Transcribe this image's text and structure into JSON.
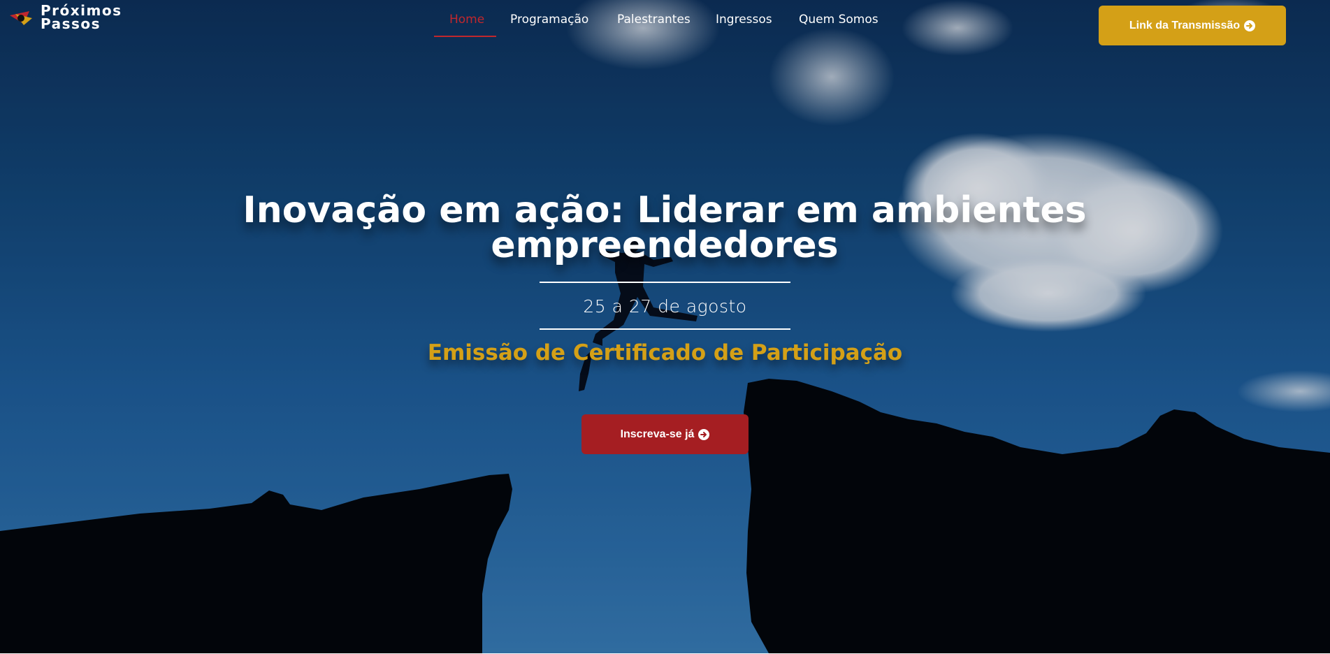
{
  "brand": {
    "name_line1": "Próximos",
    "name_line2": "Passos",
    "icon": "logo-mark-icon"
  },
  "nav": {
    "items": [
      {
        "label": "Home",
        "active": true
      },
      {
        "label": "Programação",
        "active": false
      },
      {
        "label": "Palestrantes",
        "active": false
      },
      {
        "label": "Ingressos",
        "active": false
      },
      {
        "label": "Quem Somos",
        "active": false
      }
    ]
  },
  "header": {
    "stream_button": "Link da Transmissão",
    "stream_icon": "arrow-circle-right-icon"
  },
  "hero": {
    "headline_line1": "Inovação em ação: Liderar em ambientes",
    "headline_line2": "empreendedores",
    "dates": "25 a 27 de agosto",
    "certificate": "Emissão de Certificado de Participação",
    "cta": "Inscreva-se já",
    "cta_icon": "arrow-circle-right-icon"
  },
  "colors": {
    "accent_gold": "#d4a017",
    "accent_red": "#a51e22",
    "nav_active": "#c0272d",
    "sky": "#1f5f9b"
  }
}
